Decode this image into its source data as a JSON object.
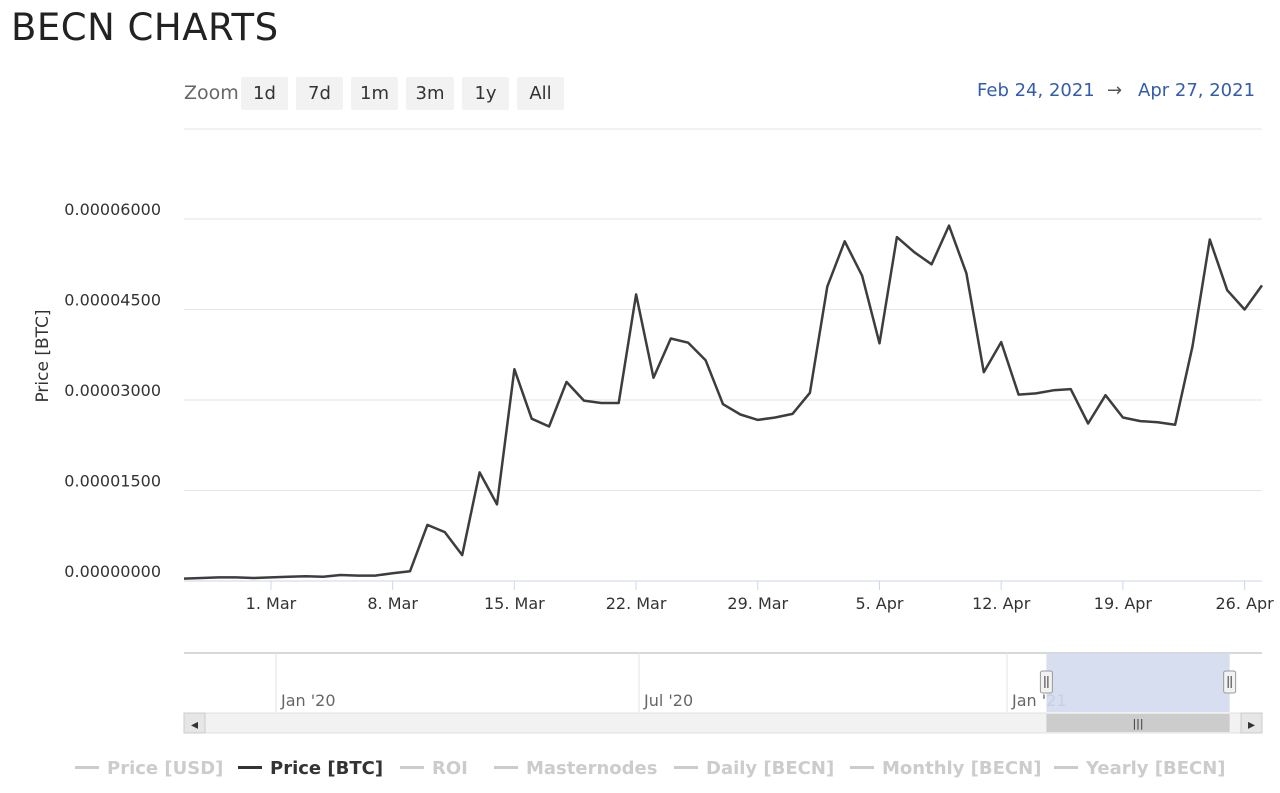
{
  "page": {
    "title": "BECN CHARTS"
  },
  "toolbar": {
    "zoom_label": "Zoom",
    "zoom_buttons": [
      "1d",
      "7d",
      "1m",
      "3m",
      "1y",
      "All"
    ],
    "range_from": "Feb 24, 2021",
    "range_arrow": "→",
    "range_to": "Apr 27, 2021"
  },
  "colors": {
    "line": "#3d3d3d",
    "grid": "#e6e6e6",
    "axis": "#ccd6eb",
    "range_text": "#335cad",
    "navigator_mask": "#d3daed",
    "legend_inactive": "#cccccc",
    "legend_active": "#333333"
  },
  "chart_data": {
    "type": "line",
    "title": "",
    "ylabel": "Price [BTC]",
    "xlabel": "",
    "ylim": [
      0,
      6.6e-05
    ],
    "yticks": [
      "0.00000000",
      "0.00001500",
      "0.00003000",
      "0.00004500",
      "0.00006000"
    ],
    "ytick_values": [
      0,
      1.5e-05,
      3e-05,
      4.5e-05,
      6e-05
    ],
    "xlim": [
      "2021-02-24",
      "2021-04-27"
    ],
    "xticks": [
      "1. Mar",
      "8. Mar",
      "15. Mar",
      "22. Mar",
      "29. Mar",
      "5. Apr",
      "12. Apr",
      "19. Apr",
      "26. Apr"
    ],
    "xtick_dates": [
      "2021-03-01",
      "2021-03-08",
      "2021-03-15",
      "2021-03-22",
      "2021-03-29",
      "2021-04-05",
      "2021-04-12",
      "2021-04-19",
      "2021-04-26"
    ],
    "grid": true,
    "series": [
      {
        "name": "Price [BTC]",
        "x": [
          "2021-02-24",
          "2021-02-25",
          "2021-02-26",
          "2021-02-27",
          "2021-02-28",
          "2021-03-01",
          "2021-03-02",
          "2021-03-03",
          "2021-03-04",
          "2021-03-05",
          "2021-03-06",
          "2021-03-07",
          "2021-03-08",
          "2021-03-09",
          "2021-03-10",
          "2021-03-11",
          "2021-03-12",
          "2021-03-13",
          "2021-03-14",
          "2021-03-15",
          "2021-03-16",
          "2021-03-17",
          "2021-03-18",
          "2021-03-19",
          "2021-03-20",
          "2021-03-21",
          "2021-03-22",
          "2021-03-23",
          "2021-03-24",
          "2021-03-25",
          "2021-03-26",
          "2021-03-27",
          "2021-03-28",
          "2021-03-29",
          "2021-03-30",
          "2021-03-31",
          "2021-04-01",
          "2021-04-02",
          "2021-04-03",
          "2021-04-04",
          "2021-04-05",
          "2021-04-06",
          "2021-04-07",
          "2021-04-08",
          "2021-04-09",
          "2021-04-10",
          "2021-04-11",
          "2021-04-12",
          "2021-04-13",
          "2021-04-14",
          "2021-04-15",
          "2021-04-16",
          "2021-04-17",
          "2021-04-18",
          "2021-04-19",
          "2021-04-20",
          "2021-04-21",
          "2021-04-22",
          "2021-04-23",
          "2021-04-24",
          "2021-04-25",
          "2021-04-26",
          "2021-04-27"
        ],
        "values": [
          4e-07,
          5e-07,
          6e-07,
          6e-07,
          5e-07,
          6e-07,
          7e-07,
          8e-07,
          7e-07,
          1e-06,
          9e-07,
          9e-07,
          1.3e-06,
          1.6e-06,
          9.3e-06,
          8.1e-06,
          4.3e-06,
          1.8e-05,
          1.27e-05,
          3.51e-05,
          2.69e-05,
          2.56e-05,
          3.3e-05,
          2.99e-05,
          2.95e-05,
          2.95e-05,
          4.75e-05,
          3.37e-05,
          4.02e-05,
          3.95e-05,
          3.66e-05,
          2.93e-05,
          2.76e-05,
          2.67e-05,
          2.71e-05,
          2.77e-05,
          3.12e-05,
          4.88e-05,
          5.63e-05,
          5.06e-05,
          3.94e-05,
          5.7e-05,
          5.45e-05,
          5.25e-05,
          5.89e-05,
          5.1e-05,
          3.46e-05,
          3.96e-05,
          3.09e-05,
          3.11e-05,
          3.16e-05,
          3.18e-05,
          2.61e-05,
          3.08e-05,
          2.71e-05,
          2.65e-05,
          2.63e-05,
          2.59e-05,
          3.89e-05,
          5.66e-05,
          4.82e-05,
          4.5e-05,
          4.9e-05
        ]
      }
    ]
  },
  "navigator": {
    "labels": [
      "Jan '20",
      "Jul '20",
      "Jan '21"
    ],
    "handle_glyph": "|||",
    "left_arrow": "◂",
    "right_arrow": "▸",
    "selected_from_fraction": 0.8,
    "selected_to_fraction": 0.97
  },
  "legend": {
    "items": [
      {
        "label": "Price [USD]",
        "active": false
      },
      {
        "label": "Price [BTC]",
        "active": true
      },
      {
        "label": "ROI",
        "active": false
      },
      {
        "label": "Masternodes",
        "active": false
      },
      {
        "label": "Daily [BECN]",
        "active": false
      },
      {
        "label": "Monthly [BECN]",
        "active": false
      },
      {
        "label": "Yearly [BECN]",
        "active": false
      }
    ]
  }
}
